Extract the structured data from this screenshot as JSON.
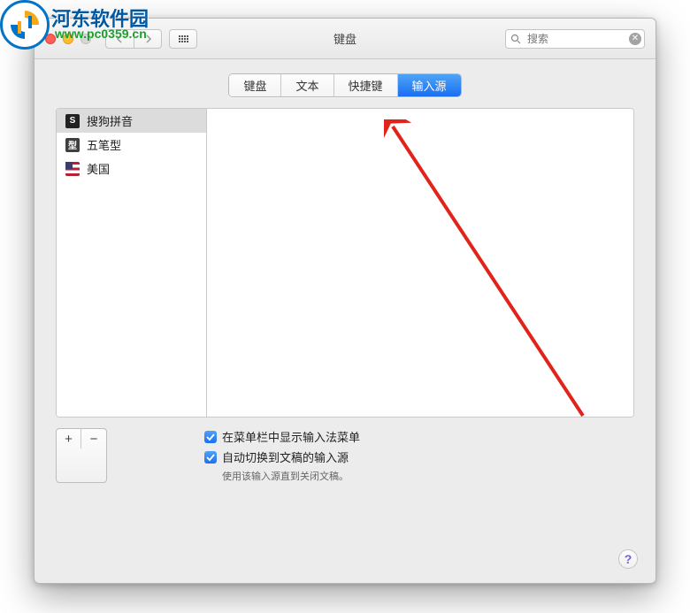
{
  "watermark": {
    "text": "河东软件园",
    "url": "www.pc0359.cn"
  },
  "window": {
    "title": "键盘"
  },
  "search": {
    "placeholder": "搜索"
  },
  "tabs": [
    {
      "label": "键盘",
      "active": false
    },
    {
      "label": "文本",
      "active": false
    },
    {
      "label": "快捷键",
      "active": false
    },
    {
      "label": "输入源",
      "active": true
    }
  ],
  "sources": [
    {
      "label": "搜狗拼音",
      "icon": "sogou",
      "iconText": "S",
      "selected": true
    },
    {
      "label": "五笔型",
      "icon": "wubi",
      "iconText": "型",
      "selected": false
    },
    {
      "label": "美国",
      "icon": "us",
      "iconText": "",
      "selected": false
    }
  ],
  "buttons": {
    "add": "+",
    "remove": "−"
  },
  "options": {
    "show_menu": "在菜单栏中显示输入法菜单",
    "auto_switch": "自动切换到文稿的输入源",
    "hint": "使用该输入源直到关闭文稿。"
  },
  "help": "?"
}
